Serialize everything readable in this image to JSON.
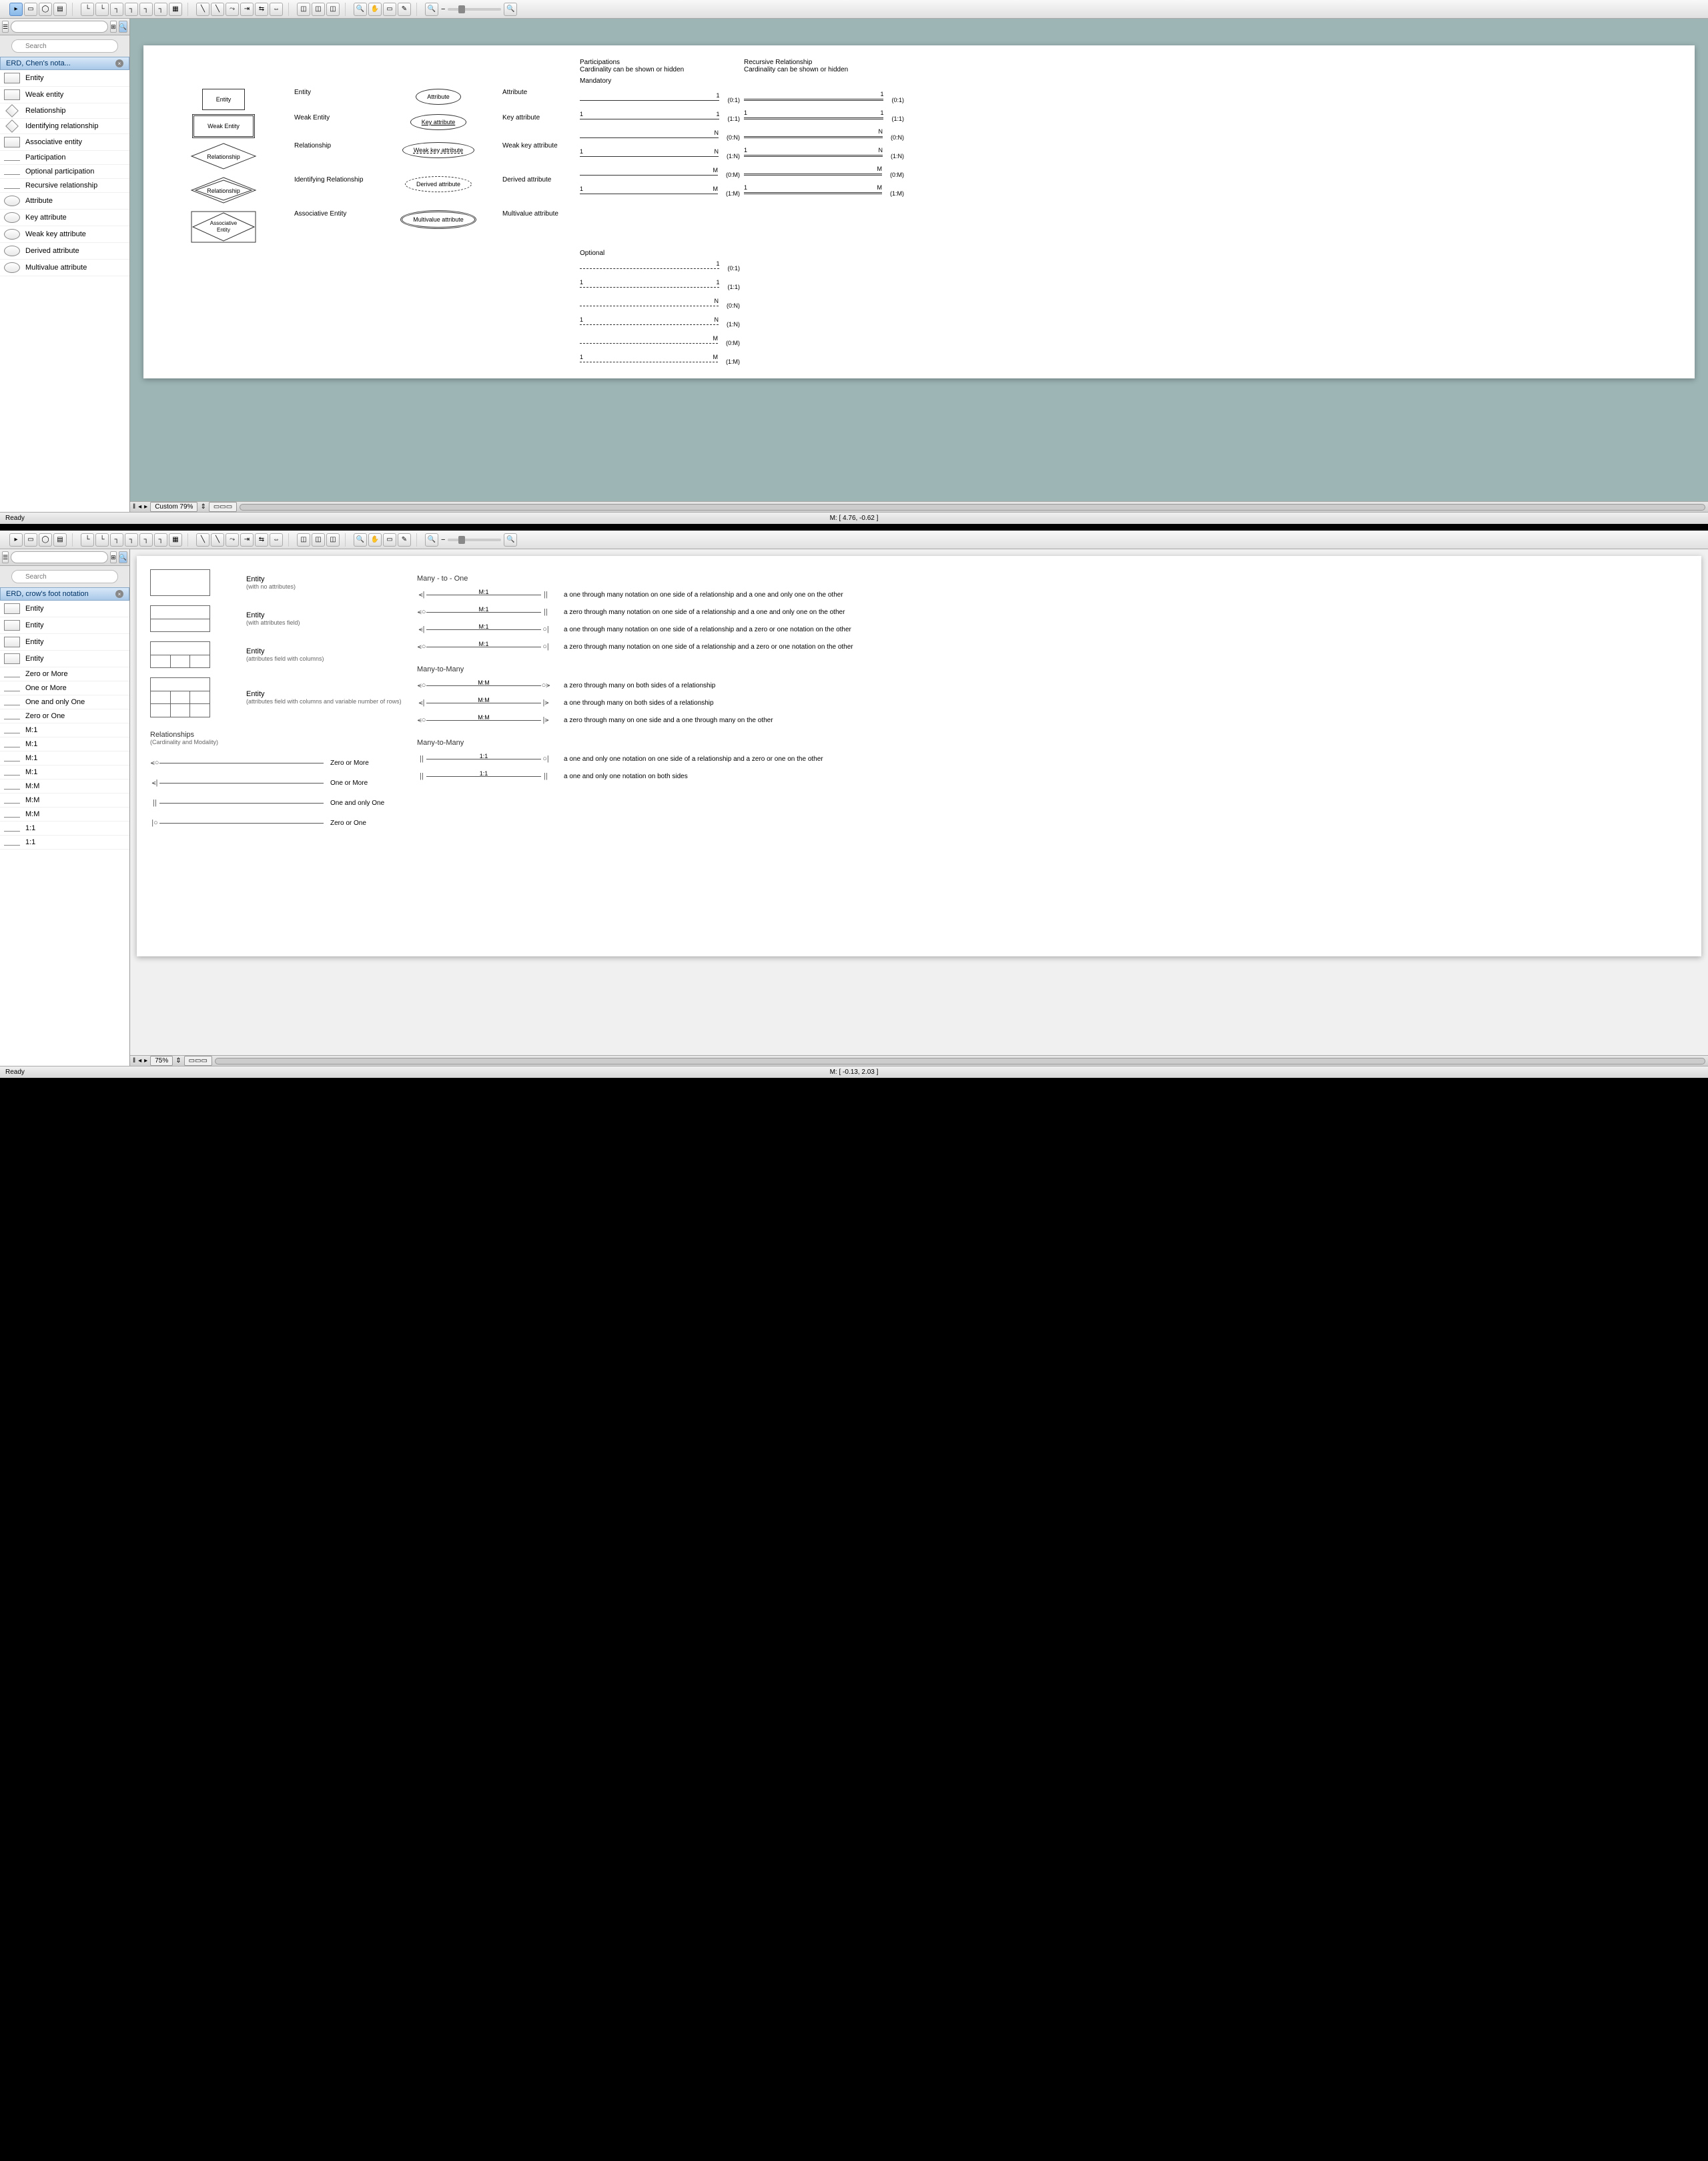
{
  "app1": {
    "search_placeholder": "Search",
    "panel_title": "ERD, Chen's nota...",
    "shapes": [
      {
        "label": "Entity",
        "kind": "rect"
      },
      {
        "label": "Weak entity",
        "kind": "rect"
      },
      {
        "label": "Relationship",
        "kind": "diamond"
      },
      {
        "label": "Identifying relationship",
        "kind": "diamond"
      },
      {
        "label": "Associative entity",
        "kind": "rect"
      },
      {
        "label": "Participation",
        "kind": "line"
      },
      {
        "label": "Optional participation",
        "kind": "line"
      },
      {
        "label": "Recursive relationship",
        "kind": "line"
      },
      {
        "label": "Attribute",
        "kind": "ellipse"
      },
      {
        "label": "Key attribute",
        "kind": "ellipse"
      },
      {
        "label": "Weak key attribute",
        "kind": "ellipse"
      },
      {
        "label": "Derived attribute",
        "kind": "ellipse"
      },
      {
        "label": "Multivalue attribute",
        "kind": "ellipse"
      }
    ],
    "zoom": "Custom 79%",
    "mouse": "M: [ 4.76, -0.62 ]",
    "status": "Ready",
    "canvas": {
      "col1": [
        {
          "shape": "Entity",
          "label": "Entity"
        },
        {
          "shape": "Weak Entity",
          "label": "Weak Entity"
        },
        {
          "shape": "Relationship",
          "label": "Relationship"
        },
        {
          "shape": "Relationship",
          "label": "Identifying Relationship"
        },
        {
          "shape": "Associative Entity",
          "label": "Associative Entity"
        }
      ],
      "col2": [
        {
          "shape": "Attribute",
          "label": "Attribute"
        },
        {
          "shape": "Key attribute",
          "label": "Key attribute"
        },
        {
          "shape": "Weak key attribute",
          "label": "Weak key attribute"
        },
        {
          "shape": "Derived attribute",
          "label": "Derived attribute"
        },
        {
          "shape": "Multivalue attribute",
          "label": "Multivalue attribute"
        }
      ],
      "part_title": "Participations",
      "part_sub": "Cardinality can be shown or hidden",
      "rec_title": "Recursive Relationship",
      "rec_sub": "Cardinality can be shown or hidden",
      "mandatory_title": "Mandatory",
      "optional_title": "Optional",
      "mandatory": [
        {
          "l": "",
          "r": "1",
          "s": "(0:1)"
        },
        {
          "l": "1",
          "r": "1",
          "s": "(1:1)"
        },
        {
          "l": "",
          "r": "N",
          "s": "(0:N)"
        },
        {
          "l": "1",
          "r": "N",
          "s": "(1:N)"
        },
        {
          "l": "",
          "r": "M",
          "s": "(0:M)"
        },
        {
          "l": "1",
          "r": "M",
          "s": "(1:M)"
        }
      ],
      "recursive": [
        {
          "l": "",
          "r": "1",
          "s": "(0:1)"
        },
        {
          "l": "1",
          "r": "1",
          "s": "(1:1)"
        },
        {
          "l": "",
          "r": "N",
          "s": "(0:N)"
        },
        {
          "l": "1",
          "r": "N",
          "s": "(1:N)"
        },
        {
          "l": "",
          "r": "M",
          "s": "(0:M)"
        },
        {
          "l": "1",
          "r": "M",
          "s": "(1:M)"
        }
      ],
      "optional": [
        {
          "l": "",
          "r": "1",
          "s": "(0:1)"
        },
        {
          "l": "1",
          "r": "1",
          "s": "(1:1)"
        },
        {
          "l": "",
          "r": "N",
          "s": "(0:N)"
        },
        {
          "l": "1",
          "r": "N",
          "s": "(1:N)"
        },
        {
          "l": "",
          "r": "M",
          "s": "(0:M)"
        },
        {
          "l": "1",
          "r": "M",
          "s": "(1:M)"
        }
      ]
    }
  },
  "app2": {
    "search_placeholder": "Search",
    "panel_title": "ERD, crow's foot notation",
    "shapes": [
      {
        "label": "Entity",
        "kind": "rect"
      },
      {
        "label": "Entity",
        "kind": "rect"
      },
      {
        "label": "Entity",
        "kind": "rect"
      },
      {
        "label": "Entity",
        "kind": "rect"
      },
      {
        "label": "Zero or More",
        "kind": "line"
      },
      {
        "label": "One or More",
        "kind": "line"
      },
      {
        "label": "One and only One",
        "kind": "line"
      },
      {
        "label": "Zero or One",
        "kind": "line"
      },
      {
        "label": "M:1",
        "kind": "line"
      },
      {
        "label": "M:1",
        "kind": "line"
      },
      {
        "label": "M:1",
        "kind": "line"
      },
      {
        "label": "M:1",
        "kind": "line"
      },
      {
        "label": "M:M",
        "kind": "line"
      },
      {
        "label": "M:M",
        "kind": "line"
      },
      {
        "label": "M:M",
        "kind": "line"
      },
      {
        "label": "1:1",
        "kind": "line"
      },
      {
        "label": "1:1",
        "kind": "line"
      }
    ],
    "zoom": "75%",
    "mouse": "M: [ -0.13, 2.03 ]",
    "status": "Ready",
    "canvas": {
      "entities": [
        {
          "title": "Entity",
          "sub": "(with no attributes)"
        },
        {
          "title": "Entity",
          "sub": "(with attributes field)"
        },
        {
          "title": "Entity",
          "sub": "(attributes field with columns)"
        },
        {
          "title": "Entity",
          "sub": "(attributes field with columns and variable number of rows)"
        }
      ],
      "rel_title": "Relationships",
      "rel_sub": "(Cardinality and Modality)",
      "basic": [
        {
          "label": "Zero or More"
        },
        {
          "label": "One or More"
        },
        {
          "label": "One and only One"
        },
        {
          "label": "Zero or One"
        }
      ],
      "m1_title": "Many - to - One",
      "m1": [
        {
          "lbl": "M:1",
          "desc": "a one through many notation on one side of a relationship and a one and only one on the other"
        },
        {
          "lbl": "M:1",
          "desc": "a zero through many notation on one side of a relationship and a one and only one on the other"
        },
        {
          "lbl": "M:1",
          "desc": "a one through many notation on one side of a relationship and a zero or one notation on the other"
        },
        {
          "lbl": "M:1",
          "desc": "a zero through many notation on one side of a relationship and a zero or one notation on the other"
        }
      ],
      "mm_title": "Many-to-Many",
      "mm": [
        {
          "lbl": "M:M",
          "desc": "a zero through many on both sides of a relationship"
        },
        {
          "lbl": "M:M",
          "desc": "a one through many on both sides of a relationship"
        },
        {
          "lbl": "M:M",
          "desc": "a zero through many on one side and a one through many on the other"
        }
      ],
      "oo_title": "Many-to-Many",
      "oo": [
        {
          "lbl": "1:1",
          "desc": "a one and only one notation on one side of a relationship and a zero or one on the other"
        },
        {
          "lbl": "1:1",
          "desc": "a one and only one notation on both sides"
        }
      ]
    }
  }
}
